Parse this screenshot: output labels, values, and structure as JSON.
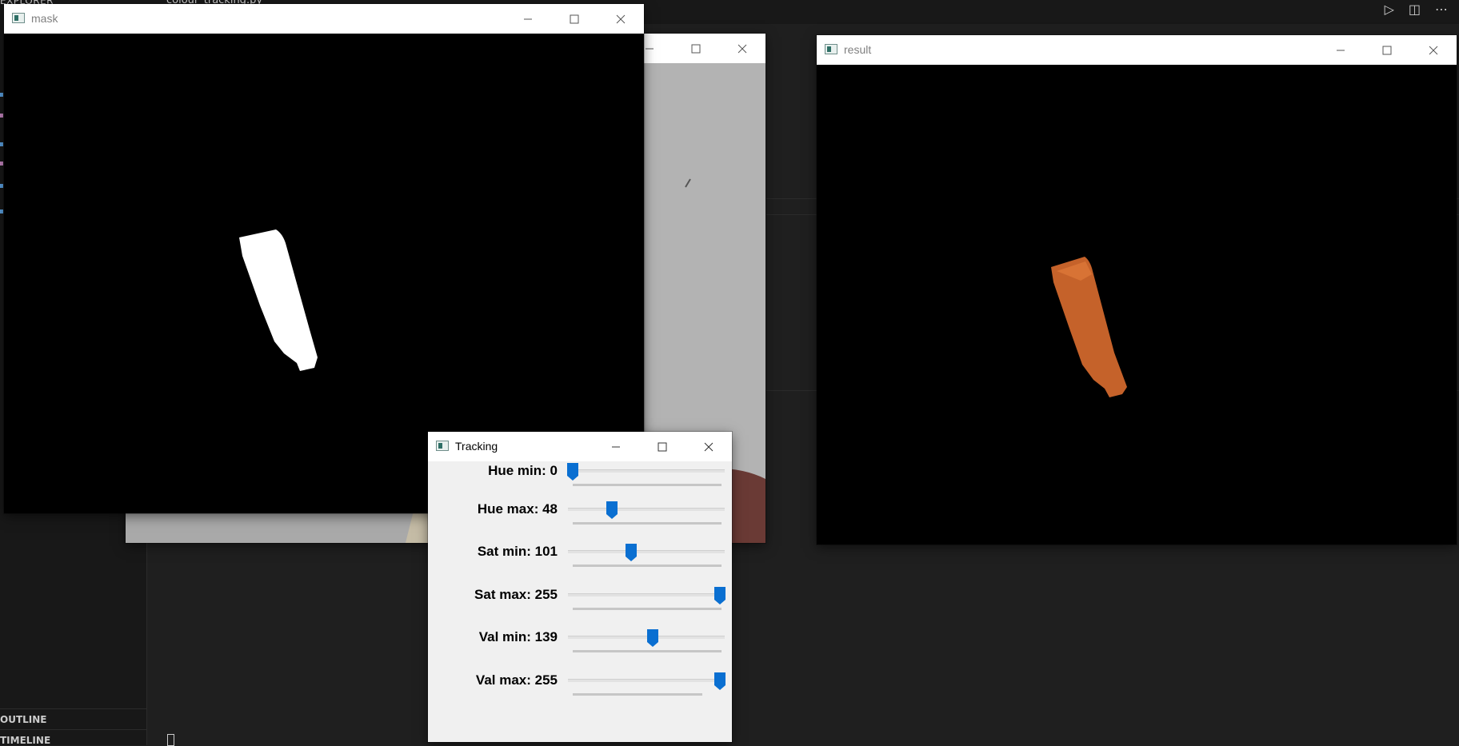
{
  "vscode": {
    "explorer_label": "EXPLORER",
    "tab_label": "colour_tracking.py",
    "outline_label": "OUTLINE",
    "timeline_label": "TIMELINE"
  },
  "windows": {
    "mask": {
      "title": "mask"
    },
    "result": {
      "title": "result"
    },
    "tracking": {
      "title": "Tracking",
      "trackbars": [
        {
          "label": "Hue min: 0",
          "value": 0,
          "max": 179
        },
        {
          "label": "Hue max: 48",
          "value": 48,
          "max": 179
        },
        {
          "label": "Sat min: 101",
          "value": 101,
          "max": 255
        },
        {
          "label": "Sat max: 255",
          "value": 255,
          "max": 255
        },
        {
          "label": "Val min: 139",
          "value": 139,
          "max": 255
        },
        {
          "label": "Val max: 255",
          "value": 255,
          "max": 255
        }
      ]
    }
  },
  "colors": {
    "thumb": "#0a6fd1",
    "mask_blob": "#ffffff",
    "result_blob": "#c5622a",
    "frame_bg": "#a9a9a9"
  }
}
